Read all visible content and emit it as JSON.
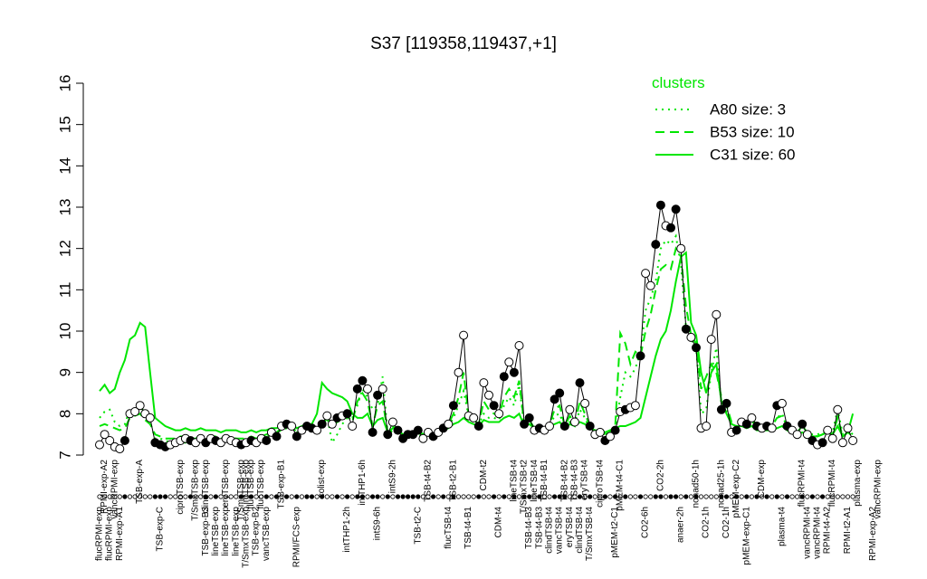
{
  "chart_data": {
    "type": "line",
    "title": "S37 [119358,119437,+1]",
    "xlabel": "",
    "ylabel": "",
    "ylim": [
      7,
      16
    ],
    "yticks": [
      7,
      8,
      9,
      10,
      11,
      12,
      13,
      14,
      15,
      16
    ],
    "x_tick_labels": [
      {
        "text": "flucRPMI-exp",
        "row": "bottom",
        "x": 1
      },
      {
        "text": "flucRPMI-exp",
        "row": "bottom",
        "x": 3
      },
      {
        "text": "RPMI-exp-A1",
        "row": "bottom",
        "x": 5
      },
      {
        "text": "TSB-exp-C",
        "row": "bottom",
        "x": 13
      },
      {
        "text": "TSB-exp-B3",
        "row": "bottom",
        "x": 22
      },
      {
        "text": "lineTSB-exp",
        "row": "bottom",
        "x": 24
      },
      {
        "text": "lineTSB-exp",
        "row": "bottom",
        "x": 26
      },
      {
        "text": "lineTSB-exp",
        "row": "bottom",
        "x": 28
      },
      {
        "text": "T/SmxTSB-exp",
        "row": "bottom",
        "x": 30
      },
      {
        "text": "TSB-exp-B2",
        "row": "bottom",
        "x": 32
      },
      {
        "text": "vancTSB-exp",
        "row": "bottom",
        "x": 34
      },
      {
        "text": "RPMI/FCS-exp",
        "row": "bottom",
        "x": 40
      },
      {
        "text": "intTHP1-2h",
        "row": "bottom",
        "x": 50
      },
      {
        "text": "intS9-6h",
        "row": "bottom",
        "x": 56
      },
      {
        "text": "TSB-t2-C",
        "row": "bottom",
        "x": 64
      },
      {
        "text": "flucTSB-t4",
        "row": "bottom",
        "x": 70
      },
      {
        "text": "TSB-t4-B1",
        "row": "bottom",
        "x": 74
      },
      {
        "text": "CDM-t4",
        "row": "bottom",
        "x": 80
      },
      {
        "text": "TSB-t4-B3",
        "row": "bottom",
        "x": 86
      },
      {
        "text": "TSB-t4-B3",
        "row": "bottom",
        "x": 88
      },
      {
        "text": "clindTSB-t4",
        "row": "bottom",
        "x": 90
      },
      {
        "text": "vancTSB-t4",
        "row": "bottom",
        "x": 92
      },
      {
        "text": "eryTSB-t4",
        "row": "bottom",
        "x": 94
      },
      {
        "text": "clindTSB-t4",
        "row": "bottom",
        "x": 96
      },
      {
        "text": "T/SmxTSB-t4",
        "row": "bottom",
        "x": 98
      },
      {
        "text": "pMEM-t2-C1",
        "row": "bottom",
        "x": 103
      },
      {
        "text": "CO2-6h",
        "row": "bottom",
        "x": 109
      },
      {
        "text": "anaer-2h",
        "row": "bottom",
        "x": 116
      },
      {
        "text": "CO2-1h",
        "row": "bottom",
        "x": 121
      },
      {
        "text": "CO2-1h",
        "row": "bottom",
        "x": 125
      },
      {
        "text": "pMEM-exp-C1",
        "row": "bottom",
        "x": 129
      },
      {
        "text": "plasma-t4",
        "row": "bottom",
        "x": 136
      },
      {
        "text": "vancRPMI-t4",
        "row": "bottom",
        "x": 141
      },
      {
        "text": "vancRPMI-t4",
        "row": "bottom",
        "x": 143
      },
      {
        "text": "RPMI-t4-A2",
        "row": "bottom",
        "x": 145
      },
      {
        "text": "RPMI-t2-A1",
        "row": "bottom",
        "x": 149
      },
      {
        "text": "RPMI-exp-A2",
        "row": "bottom",
        "x": 154
      },
      {
        "text": "RPMI-exp-A2",
        "row": "top",
        "x": 2
      },
      {
        "text": "vancRPMI-exp",
        "row": "top",
        "x": 4
      },
      {
        "text": "TSB-exp-A",
        "row": "top",
        "x": 9
      },
      {
        "text": "ciproTSB-exp",
        "row": "top",
        "x": 17
      },
      {
        "text": "T/SmxTSB-exp",
        "row": "top",
        "x": 20
      },
      {
        "text": "clindTSB-exp",
        "row": "top",
        "x": 22
      },
      {
        "text": "eryTSB-exp",
        "row": "top",
        "x": 26
      },
      {
        "text": "T/SmxTSB-exp",
        "row": "top",
        "x": 29
      },
      {
        "text": "intTSB-exp",
        "row": "top",
        "x": 30
      },
      {
        "text": "flucTSB-exp",
        "row": "top",
        "x": 31
      },
      {
        "text": "flucTSB-exp",
        "row": "top",
        "x": 33
      },
      {
        "text": "TSB-exp-B1",
        "row": "top",
        "x": 37
      },
      {
        "text": "colist-exp",
        "row": "top",
        "x": 45
      },
      {
        "text": "intTHP1-6h",
        "row": "top",
        "x": 53
      },
      {
        "text": "intS9-2h",
        "row": "top",
        "x": 59
      },
      {
        "text": "TSB-t4-B2",
        "row": "top",
        "x": 66
      },
      {
        "text": "TSB-t2-B1",
        "row": "top",
        "x": 71
      },
      {
        "text": "CDM-t2",
        "row": "top",
        "x": 77
      },
      {
        "text": "lineTSB-t4",
        "row": "top",
        "x": 83
      },
      {
        "text": "T/SmxTSB-t2",
        "row": "top",
        "x": 85
      },
      {
        "text": "lineTSB-t4",
        "row": "top",
        "x": 87
      },
      {
        "text": "TSB-t4-B1",
        "row": "top",
        "x": 89
      },
      {
        "text": "TSB-t4-B2",
        "row": "top",
        "x": 93
      },
      {
        "text": "TSB-t4-B3",
        "row": "top",
        "x": 95
      },
      {
        "text": "eryTSB-t4",
        "row": "top",
        "x": 97
      },
      {
        "text": "ciproTSB-t4",
        "row": "top",
        "x": 100
      },
      {
        "text": "pMEM-t4-C1",
        "row": "top",
        "x": 104
      },
      {
        "text": "CO2-2h",
        "row": "top",
        "x": 112
      },
      {
        "text": "nonad50-1h",
        "row": "top",
        "x": 119
      },
      {
        "text": "nonad25-1h",
        "row": "top",
        "x": 124
      },
      {
        "text": "pMEM-exp-C2",
        "row": "top",
        "x": 127
      },
      {
        "text": "CDM-exp",
        "row": "top",
        "x": 132
      },
      {
        "text": "flucRPMI-t4",
        "row": "top",
        "x": 140
      },
      {
        "text": "flucRPMI-t4",
        "row": "top",
        "x": 146
      },
      {
        "text": "plasma-exp",
        "row": "top",
        "x": 151
      },
      {
        "text": "vancRPMI-exp",
        "row": "top",
        "x": 155
      }
    ],
    "x_positions": [
      1,
      2,
      3,
      4,
      5,
      6,
      7,
      8,
      9,
      10,
      11,
      12,
      13,
      14,
      15,
      16,
      17,
      18,
      19,
      20,
      21,
      22,
      23,
      24,
      25,
      26,
      27,
      28,
      29,
      30,
      31,
      32,
      33,
      34,
      35,
      36,
      37,
      38,
      39,
      40,
      41,
      42,
      43,
      44,
      45,
      46,
      47,
      48,
      49,
      50,
      51,
      52,
      53,
      54,
      55,
      56,
      57,
      58,
      59,
      60,
      61,
      62,
      63,
      64,
      65,
      66,
      67,
      68,
      69,
      70,
      71,
      72,
      73,
      74,
      75,
      76,
      77,
      78,
      79,
      80,
      81,
      82,
      83,
      84,
      85,
      86,
      87,
      88,
      89,
      90,
      91,
      92,
      93,
      94,
      95,
      96,
      97,
      98,
      99,
      100,
      101,
      102,
      103,
      104,
      105,
      106,
      107,
      108,
      109,
      110,
      111,
      112,
      113,
      114,
      115,
      116,
      117,
      118,
      119,
      120,
      121,
      122,
      123,
      124,
      125,
      126,
      127,
      128,
      129,
      130,
      131,
      132,
      133,
      134,
      135,
      136,
      137,
      138,
      139,
      140,
      141,
      142,
      143,
      144,
      145,
      146,
      147,
      148,
      149,
      150,
      151,
      152,
      153,
      154,
      155
    ],
    "series": [
      {
        "name": "main",
        "color": "#000000",
        "values": [
          7.25,
          7.5,
          7.35,
          7.2,
          7.15,
          7.35,
          8.0,
          8.05,
          8.2,
          8.0,
          7.9,
          7.3,
          7.25,
          7.2,
          7.25,
          7.3,
          7.35,
          7.4,
          7.35,
          7.3,
          7.4,
          7.3,
          7.4,
          7.35,
          7.3,
          7.4,
          7.35,
          7.3,
          7.25,
          7.3,
          7.35,
          7.3,
          7.4,
          7.35,
          7.55,
          7.45,
          7.7,
          7.75,
          7.7,
          7.45,
          7.6,
          7.7,
          7.65,
          7.6,
          7.75,
          7.95,
          7.75,
          7.9,
          7.95,
          8.0,
          7.7,
          8.6,
          8.8,
          8.6,
          7.55,
          8.45,
          8.6,
          7.5,
          7.8,
          7.6,
          7.4,
          7.5,
          7.5,
          7.6,
          7.4,
          7.55,
          7.45,
          7.55,
          7.65,
          7.75,
          8.2,
          9.0,
          9.9,
          7.95,
          7.9,
          7.7,
          8.75,
          8.45,
          8.2,
          8.0,
          8.9,
          9.25,
          9.0,
          9.65,
          7.75,
          7.9,
          7.6,
          7.65,
          7.6,
          7.7,
          8.35,
          8.5,
          7.7,
          8.1,
          7.8,
          8.75,
          8.25,
          7.7,
          7.5,
          7.55,
          7.35,
          7.45,
          7.6,
          8.05,
          8.1,
          8.15,
          8.2,
          9.4,
          11.4,
          11.1,
          12.1,
          13.05,
          12.55,
          12.5,
          12.95,
          12.0,
          10.05,
          9.85,
          9.6,
          7.65,
          7.7,
          9.8,
          10.4,
          8.1,
          8.25,
          7.55,
          7.6,
          7.8,
          7.75,
          7.9,
          7.7,
          7.65,
          7.7,
          7.65,
          8.2,
          8.25,
          7.7,
          7.6,
          7.5,
          7.75,
          7.5,
          7.35,
          7.25,
          7.3,
          7.6,
          7.4,
          8.1,
          7.3,
          7.65,
          7.35
        ],
        "markers": "ooooo●ooooo●●●oooo●oo●o●oooo●o●oo●o●o●o●o●●o●oo●o●o●●o●●o●o●●●●●oo●o●o●oooo●oo●o●o●o●●o●oo●●●oo●o●oo●o●o●oo●oo●●o●●o●o●oooo●●o●o●o●o●o●o●oo●o●o●ooo"
      },
      {
        "name": "A80 size: 3",
        "color": "#00e600",
        "style": "dotted",
        "values": [
          7.9,
          8.05,
          8.1,
          7.8,
          7.7,
          7.75,
          8.1,
          8.1,
          8.2,
          8.0,
          7.8,
          7.4,
          7.4,
          7.35,
          7.3,
          7.35,
          7.3,
          7.3,
          7.35,
          7.3,
          7.35,
          7.3,
          7.35,
          7.35,
          7.3,
          7.35,
          7.3,
          7.35,
          7.35,
          7.4,
          7.4,
          7.35,
          7.4,
          7.45,
          7.5,
          7.55,
          7.6,
          7.65,
          7.65,
          7.55,
          7.6,
          7.6,
          7.65,
          7.6,
          7.7,
          7.95,
          7.3,
          7.5,
          7.75,
          7.9,
          7.9,
          8.2,
          8.6,
          8.4,
          8.1,
          8.2,
          8.9,
          7.5,
          7.6,
          7.55,
          7.45,
          7.45,
          7.5,
          7.5,
          7.45,
          7.5,
          7.5,
          7.5,
          7.6,
          7.7,
          7.9,
          8.2,
          8.55,
          7.95,
          7.8,
          7.75,
          8.0,
          7.9,
          7.9,
          7.85,
          8.2,
          8.4,
          8.2,
          8.7,
          7.7,
          7.75,
          7.65,
          7.65,
          7.6,
          7.7,
          7.95,
          8.0,
          7.65,
          7.8,
          7.7,
          8.1,
          7.9,
          7.6,
          7.5,
          7.55,
          7.5,
          7.55,
          7.65,
          8.4,
          9.0,
          8.9,
          9.1,
          9.5,
          10.5,
          10.8,
          11.2,
          12.0,
          12.2,
          12.1,
          12.3,
          11.6,
          10.1,
          9.8,
          9.6,
          8.0,
          8.1,
          9.0,
          9.6,
          8.2,
          8.1,
          7.75,
          7.7,
          7.8,
          7.75,
          7.8,
          7.75,
          7.7,
          7.7,
          7.7,
          7.9,
          8.0,
          7.7,
          7.6,
          7.55,
          7.7,
          7.55,
          7.5,
          7.5,
          7.55,
          7.6,
          7.55,
          8.1,
          7.5,
          7.6,
          7.5
        ]
      },
      {
        "name": "B53 size: 10",
        "color": "#00e600",
        "style": "dashed",
        "values": [
          7.7,
          7.75,
          7.7,
          7.65,
          7.6,
          7.65,
          7.9,
          7.95,
          8.0,
          7.85,
          7.75,
          7.5,
          7.45,
          7.4,
          7.4,
          7.4,
          7.45,
          7.45,
          7.4,
          7.4,
          7.45,
          7.4,
          7.45,
          7.45,
          7.4,
          7.45,
          7.45,
          7.4,
          7.4,
          7.4,
          7.45,
          7.4,
          7.45,
          7.5,
          7.55,
          7.55,
          7.65,
          7.7,
          7.7,
          7.55,
          7.6,
          7.65,
          7.65,
          7.6,
          7.7,
          7.9,
          7.7,
          7.8,
          7.85,
          7.95,
          7.8,
          8.3,
          8.5,
          8.3,
          7.7,
          8.2,
          8.3,
          7.55,
          7.7,
          7.6,
          7.5,
          7.55,
          7.55,
          7.6,
          7.5,
          7.6,
          7.5,
          7.55,
          7.65,
          7.75,
          8.0,
          8.4,
          9.0,
          7.95,
          7.85,
          7.75,
          8.3,
          8.1,
          8.0,
          7.95,
          8.4,
          8.6,
          8.4,
          8.8,
          7.75,
          7.85,
          7.65,
          7.7,
          7.65,
          7.75,
          8.1,
          8.2,
          7.7,
          7.95,
          7.75,
          8.3,
          8.0,
          7.7,
          7.55,
          7.6,
          7.5,
          7.55,
          7.7,
          9.95,
          9.7,
          9.2,
          9.5,
          9.4,
          10.0,
          10.4,
          11.0,
          11.5,
          11.6,
          11.5,
          12.0,
          11.8,
          10.6,
          9.9,
          9.7,
          8.6,
          8.9,
          9.2,
          9.0,
          8.4,
          8.2,
          7.8,
          7.8,
          7.85,
          7.8,
          7.85,
          7.75,
          7.7,
          7.7,
          7.7,
          7.9,
          7.95,
          7.7,
          7.6,
          7.55,
          7.7,
          7.55,
          7.5,
          7.45,
          7.5,
          7.6,
          7.5,
          7.9,
          7.45,
          7.55,
          7.45
        ]
      },
      {
        "name": "C31 size: 60",
        "color": "#00e600",
        "style": "solid",
        "values": [
          8.55,
          8.7,
          8.5,
          8.6,
          9.0,
          9.3,
          9.8,
          9.9,
          10.2,
          10.1,
          9.0,
          7.9,
          7.8,
          7.7,
          7.65,
          7.6,
          7.6,
          7.65,
          7.6,
          7.6,
          7.65,
          7.6,
          7.6,
          7.6,
          7.55,
          7.6,
          7.6,
          7.6,
          7.55,
          7.55,
          7.6,
          7.55,
          7.6,
          7.6,
          7.65,
          7.65,
          7.7,
          7.75,
          7.75,
          7.65,
          7.7,
          7.75,
          7.75,
          8.0,
          8.75,
          8.6,
          8.5,
          8.45,
          8.4,
          8.3,
          8.0,
          7.9,
          7.9,
          8.0,
          7.7,
          7.85,
          7.9,
          7.55,
          7.65,
          7.6,
          7.5,
          7.55,
          7.55,
          7.6,
          7.5,
          7.55,
          7.5,
          7.55,
          7.6,
          7.65,
          7.75,
          7.8,
          7.9,
          7.8,
          7.75,
          7.7,
          7.85,
          7.8,
          7.8,
          7.8,
          7.9,
          7.95,
          7.9,
          8.0,
          7.7,
          7.75,
          7.65,
          7.7,
          7.65,
          7.7,
          7.75,
          7.8,
          7.65,
          7.75,
          7.7,
          7.8,
          7.75,
          7.65,
          7.6,
          7.6,
          7.55,
          7.6,
          7.65,
          7.7,
          7.7,
          7.75,
          7.8,
          7.9,
          8.4,
          8.9,
          9.4,
          9.8,
          10.0,
          10.5,
          11.2,
          11.8,
          11.9,
          10.2,
          9.9,
          9.0,
          8.5,
          9.0,
          9.2,
          8.3,
          8.0,
          7.75,
          7.7,
          7.7,
          7.65,
          7.7,
          7.6,
          7.6,
          7.6,
          7.6,
          7.65,
          7.7,
          7.6,
          7.55,
          7.5,
          7.55,
          7.5,
          7.45,
          7.45,
          7.5,
          7.55,
          7.5,
          7.7,
          7.45,
          7.55,
          8.0
        ]
      }
    ],
    "legend": {
      "title": "clusters",
      "position": "top-right",
      "entries": [
        {
          "label": "A80 size: 3",
          "style": "dotted"
        },
        {
          "label": "B53 size: 10",
          "style": "dashed"
        },
        {
          "label": "C31 size: 60",
          "style": "solid"
        }
      ]
    },
    "grid": false
  }
}
